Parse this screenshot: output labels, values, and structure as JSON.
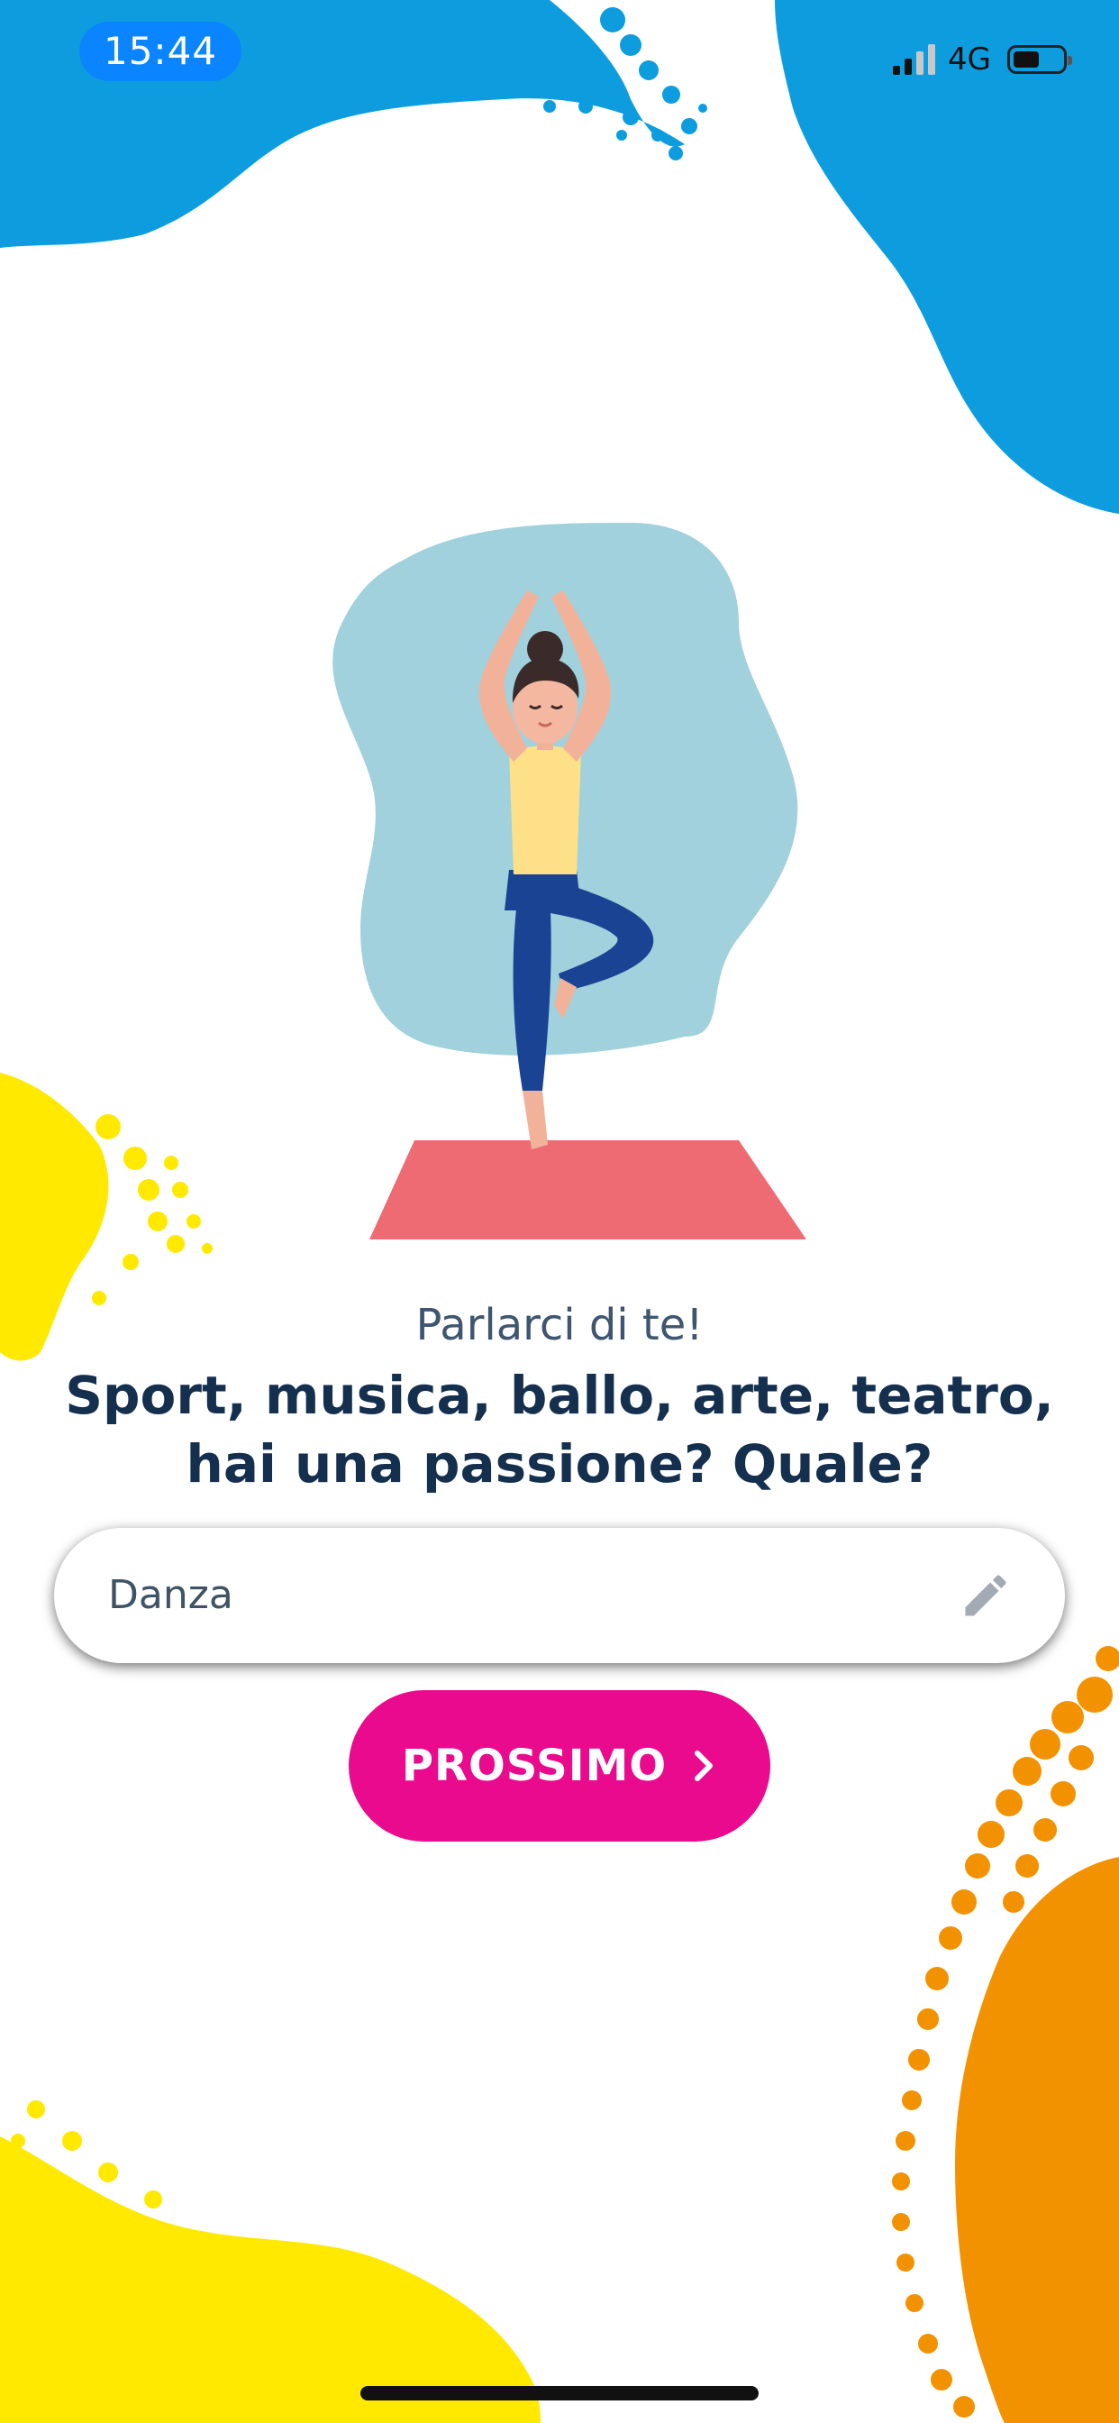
{
  "status_bar": {
    "time": "15:44",
    "network": "4G",
    "time_pill_color": "#0a84ff"
  },
  "prompt": {
    "subtitle": "Parlarci di te!",
    "question": "Sport, musica, ballo, arte, teatro, hai una passione? Quale?"
  },
  "answer_field": {
    "value": "Danza",
    "icon": "pencil-icon"
  },
  "next_button": {
    "label": "PROSSIMO",
    "icon": "chevron-right-icon",
    "color": "#ea0a8e"
  },
  "colors": {
    "blue_splash": "#0d9ddf",
    "yellow_splash": "#ffe900",
    "orange_splash": "#f39200",
    "text_dark": "#15304f",
    "text_muted": "#3e5670"
  }
}
